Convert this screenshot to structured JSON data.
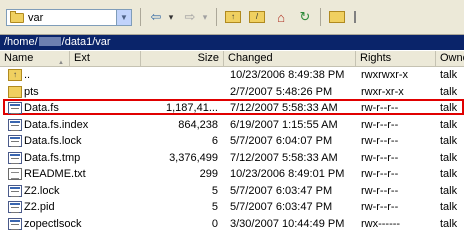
{
  "toolbar": {
    "path_value": "var",
    "back_arrow": "⇦",
    "forward_arrow": "⇨",
    "dropdown_arrow": "▾"
  },
  "address": {
    "prefix": "/home/",
    "suffix": "/data1/var"
  },
  "columns": {
    "name": "Name",
    "ext": "Ext",
    "size": "Size",
    "changed": "Changed",
    "rights": "Rights",
    "owner": "Owne"
  },
  "files": [
    {
      "name": "..",
      "size": "",
      "changed": "10/23/2006 8:49:38 PM",
      "rights": "rwxrwxr-x",
      "owner": "talk",
      "icon": "folder-up-icon"
    },
    {
      "name": "pts",
      "size": "",
      "changed": "2/7/2007 5:48:26 PM",
      "rights": "rwxr-xr-x",
      "owner": "talk",
      "icon": "folder-icon"
    },
    {
      "name": "Data.fs",
      "size": "1,187,41...",
      "changed": "7/12/2007 5:58:33 AM",
      "rights": "rw-r--r--",
      "owner": "talk",
      "icon": "database-file-icon"
    },
    {
      "name": "Data.fs.index",
      "size": "864,238",
      "changed": "6/19/2007 1:15:55 AM",
      "rights": "rw-r--r--",
      "owner": "talk",
      "icon": "database-file-icon"
    },
    {
      "name": "Data.fs.lock",
      "size": "6",
      "changed": "5/7/2007 6:04:07 PM",
      "rights": "rw-r--r--",
      "owner": "talk",
      "icon": "database-file-icon"
    },
    {
      "name": "Data.fs.tmp",
      "size": "3,376,499",
      "changed": "7/12/2007 5:58:33 AM",
      "rights": "rw-r--r--",
      "owner": "talk",
      "icon": "database-file-icon"
    },
    {
      "name": "README.txt",
      "size": "299",
      "changed": "10/23/2006 8:49:01 PM",
      "rights": "rw-r--r--",
      "owner": "talk",
      "icon": "text-file-icon"
    },
    {
      "name": "Z2.lock",
      "size": "5",
      "changed": "5/7/2007 6:03:47 PM",
      "rights": "rw-r--r--",
      "owner": "talk",
      "icon": "database-file-icon"
    },
    {
      "name": "Z2.pid",
      "size": "5",
      "changed": "5/7/2007 6:03:47 PM",
      "rights": "rw-r--r--",
      "owner": "talk",
      "icon": "database-file-icon"
    },
    {
      "name": "zopectlsock",
      "size": "0",
      "changed": "3/30/2007 10:44:49 PM",
      "rights": "rwx------",
      "owner": "talk",
      "icon": "database-file-icon"
    }
  ],
  "selected_file": "Data.fs",
  "colors": {
    "address_bg": "#0a246a",
    "highlight_border": "#e00000"
  }
}
